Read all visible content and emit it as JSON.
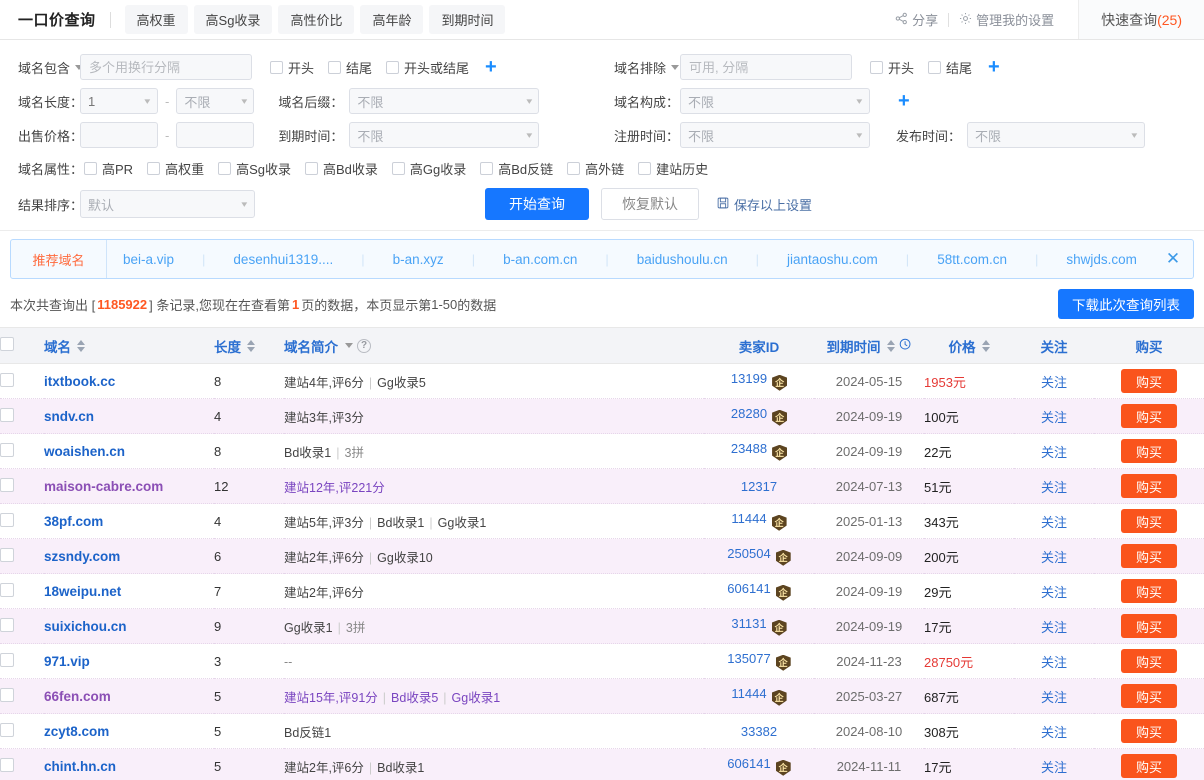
{
  "header": {
    "title": "一口价查询",
    "tabs": [
      "高权重",
      "高Sg收录",
      "高性价比",
      "高年龄",
      "到期时间"
    ],
    "share_label": "分享",
    "share_icon": "share-icon",
    "settings_label": "管理我的设置",
    "settings_icon": "gear-icon",
    "quick_query_label": "快速查询",
    "quick_query_count": "(25)"
  },
  "filters": {
    "include": {
      "label": "域名包含",
      "placeholder": "多个用换行分隔",
      "value": "",
      "checks": [
        "开头",
        "结尾",
        "开头或结尾"
      ],
      "add_icon": "plus-icon"
    },
    "exclude": {
      "label": "域名排除",
      "placeholder": "可用, 分隔",
      "value": "",
      "checks": [
        "开头",
        "结尾"
      ],
      "add_icon": "plus-icon"
    },
    "length": {
      "label": "域名长度：",
      "from": "1",
      "to": "不限",
      "sep": "-"
    },
    "suffix": {
      "label": "域名后缀：",
      "value": "不限"
    },
    "composition": {
      "label": "域名构成：",
      "value": "不限",
      "add_icon": "plus-icon"
    },
    "price": {
      "label": "出售价格：",
      "from": "",
      "to": "",
      "sep": "-"
    },
    "expire": {
      "label": "到期时间：",
      "value": "不限"
    },
    "register": {
      "label": "注册时间：",
      "value": "不限"
    },
    "publish": {
      "label": "发布时间：",
      "value": "不限"
    },
    "attributes": {
      "label": "域名属性：",
      "items": [
        "高PR",
        "高权重",
        "高Sg收录",
        "高Bd收录",
        "高Gg收录",
        "高Bd反链",
        "高外链",
        "建站历史"
      ]
    },
    "sort": {
      "label": "结果排序：",
      "value": "默认"
    },
    "submit_label": "开始查询",
    "reset_label": "恢复默认",
    "save_label": "保存以上设置",
    "save_icon": "save-disk-icon"
  },
  "recommend": {
    "label": "推荐域名",
    "items": [
      "bei-a.vip",
      "desenhui1319....",
      "b-an.xyz",
      "b-an.com.cn",
      "baidushoulu.cn",
      "jiantaoshu.com",
      "58tt.com.cn",
      "shwjds.com"
    ],
    "close_icon": "close-icon"
  },
  "summary": {
    "prefix": "本次共查询出 [",
    "total": "1185922",
    "mid": "] 条记录,您现在在查看第",
    "page": "1",
    "mid2": "页的数据，本页显示第",
    "range": "1-50",
    "suffix": "的数据",
    "download_label": "下载此次查询列表"
  },
  "table": {
    "columns": [
      {
        "key": "domain",
        "label": "域名",
        "sortable": true
      },
      {
        "key": "length",
        "label": "长度",
        "sortable": true
      },
      {
        "key": "desc",
        "label": "域名简介",
        "sortable": false,
        "dropdown": true,
        "help": true
      },
      {
        "key": "seller",
        "label": "卖家ID",
        "sortable": false
      },
      {
        "key": "expire",
        "label": "到期时间",
        "sortable": true,
        "clock": true
      },
      {
        "key": "price",
        "label": "价格",
        "sortable": true
      },
      {
        "key": "follow",
        "label": "关注",
        "sortable": false
      },
      {
        "key": "buy",
        "label": "购买",
        "sortable": false
      }
    ],
    "follow_label": "关注",
    "buy_label": "购买",
    "rows": [
      {
        "domain": "itxtbook.cc",
        "visited": false,
        "length": "8",
        "desc": [
          {
            "t": "建站4年,评6分"
          },
          {
            "p": true
          },
          {
            "t": "Gg收录5"
          }
        ],
        "desc_visited": false,
        "seller": "13199",
        "badge": true,
        "expire": "2024-05-15",
        "price": "1953元",
        "price_hot": true
      },
      {
        "domain": "sndv.cn",
        "visited": false,
        "length": "4",
        "desc": [
          {
            "t": "建站3年,评3分"
          }
        ],
        "desc_visited": false,
        "seller": "28280",
        "badge": true,
        "expire": "2024-09-19",
        "price": "100元",
        "price_hot": false
      },
      {
        "domain": "woaishen.cn",
        "visited": false,
        "length": "8",
        "desc": [
          {
            "t": "Bd收录1"
          },
          {
            "p": true
          },
          {
            "t": "3拼",
            "muted": true
          }
        ],
        "desc_visited": false,
        "seller": "23488",
        "badge": true,
        "expire": "2024-09-19",
        "price": "22元",
        "price_hot": false
      },
      {
        "domain": "maison-cabre.com",
        "visited": true,
        "length": "12",
        "desc": [
          {
            "t": "建站12年,评221分"
          }
        ],
        "desc_visited": true,
        "seller": "12317",
        "badge": false,
        "expire": "2024-07-13",
        "price": "51元",
        "price_hot": false
      },
      {
        "domain": "38pf.com",
        "visited": false,
        "length": "4",
        "desc": [
          {
            "t": "建站5年,评3分"
          },
          {
            "p": true
          },
          {
            "t": "Bd收录1"
          },
          {
            "p": true
          },
          {
            "t": "Gg收录1"
          }
        ],
        "desc_visited": false,
        "seller": "11444",
        "badge": true,
        "expire": "2025-01-13",
        "price": "343元",
        "price_hot": false
      },
      {
        "domain": "szsndy.com",
        "visited": false,
        "length": "6",
        "desc": [
          {
            "t": "建站2年,评6分"
          },
          {
            "p": true
          },
          {
            "t": "Gg收录10"
          }
        ],
        "desc_visited": false,
        "seller": "250504",
        "badge": true,
        "expire": "2024-09-09",
        "price": "200元",
        "price_hot": false
      },
      {
        "domain": "18weipu.net",
        "visited": false,
        "length": "7",
        "desc": [
          {
            "t": "建站2年,评6分"
          }
        ],
        "desc_visited": false,
        "seller": "606141",
        "badge": true,
        "expire": "2024-09-19",
        "price": "29元",
        "price_hot": false
      },
      {
        "domain": "suixichou.cn",
        "visited": false,
        "length": "9",
        "desc": [
          {
            "t": "Gg收录1"
          },
          {
            "p": true
          },
          {
            "t": "3拼",
            "muted": true
          }
        ],
        "desc_visited": false,
        "seller": "31131",
        "badge": true,
        "expire": "2024-09-19",
        "price": "17元",
        "price_hot": false
      },
      {
        "domain": "971.vip",
        "visited": false,
        "length": "3",
        "desc": [
          {
            "t": "--",
            "muted": true
          }
        ],
        "desc_visited": false,
        "seller": "135077",
        "badge": true,
        "expire": "2024-11-23",
        "price": "28750元",
        "price_hot": true
      },
      {
        "domain": "66fen.com",
        "visited": true,
        "length": "5",
        "desc": [
          {
            "t": "建站15年,评91分",
            "hl": true
          },
          {
            "p": true
          },
          {
            "t": "Bd收录5"
          },
          {
            "p": true
          },
          {
            "t": "Gg收录1"
          }
        ],
        "desc_visited": true,
        "seller": "11444",
        "badge": true,
        "expire": "2025-03-27",
        "price": "687元",
        "price_hot": false
      },
      {
        "domain": "zcyt8.com",
        "visited": false,
        "length": "5",
        "desc": [
          {
            "t": "Bd反链1"
          }
        ],
        "desc_visited": false,
        "seller": "33382",
        "badge": false,
        "expire": "2024-08-10",
        "price": "308元",
        "price_hot": false
      },
      {
        "domain": "chint.hn.cn",
        "visited": false,
        "length": "5",
        "desc": [
          {
            "t": "建站2年,评6分"
          },
          {
            "p": true
          },
          {
            "t": "Bd收录1"
          }
        ],
        "desc_visited": false,
        "seller": "606141",
        "badge": true,
        "expire": "2024-11-11",
        "price": "17元",
        "price_hot": false
      }
    ]
  },
  "colors": {
    "accent": "#1677ff",
    "buy": "#fa541c",
    "link": "#1c63c9",
    "visited": "#8b4fb5",
    "hot": "#e53935",
    "row_even": "#f9effa"
  }
}
